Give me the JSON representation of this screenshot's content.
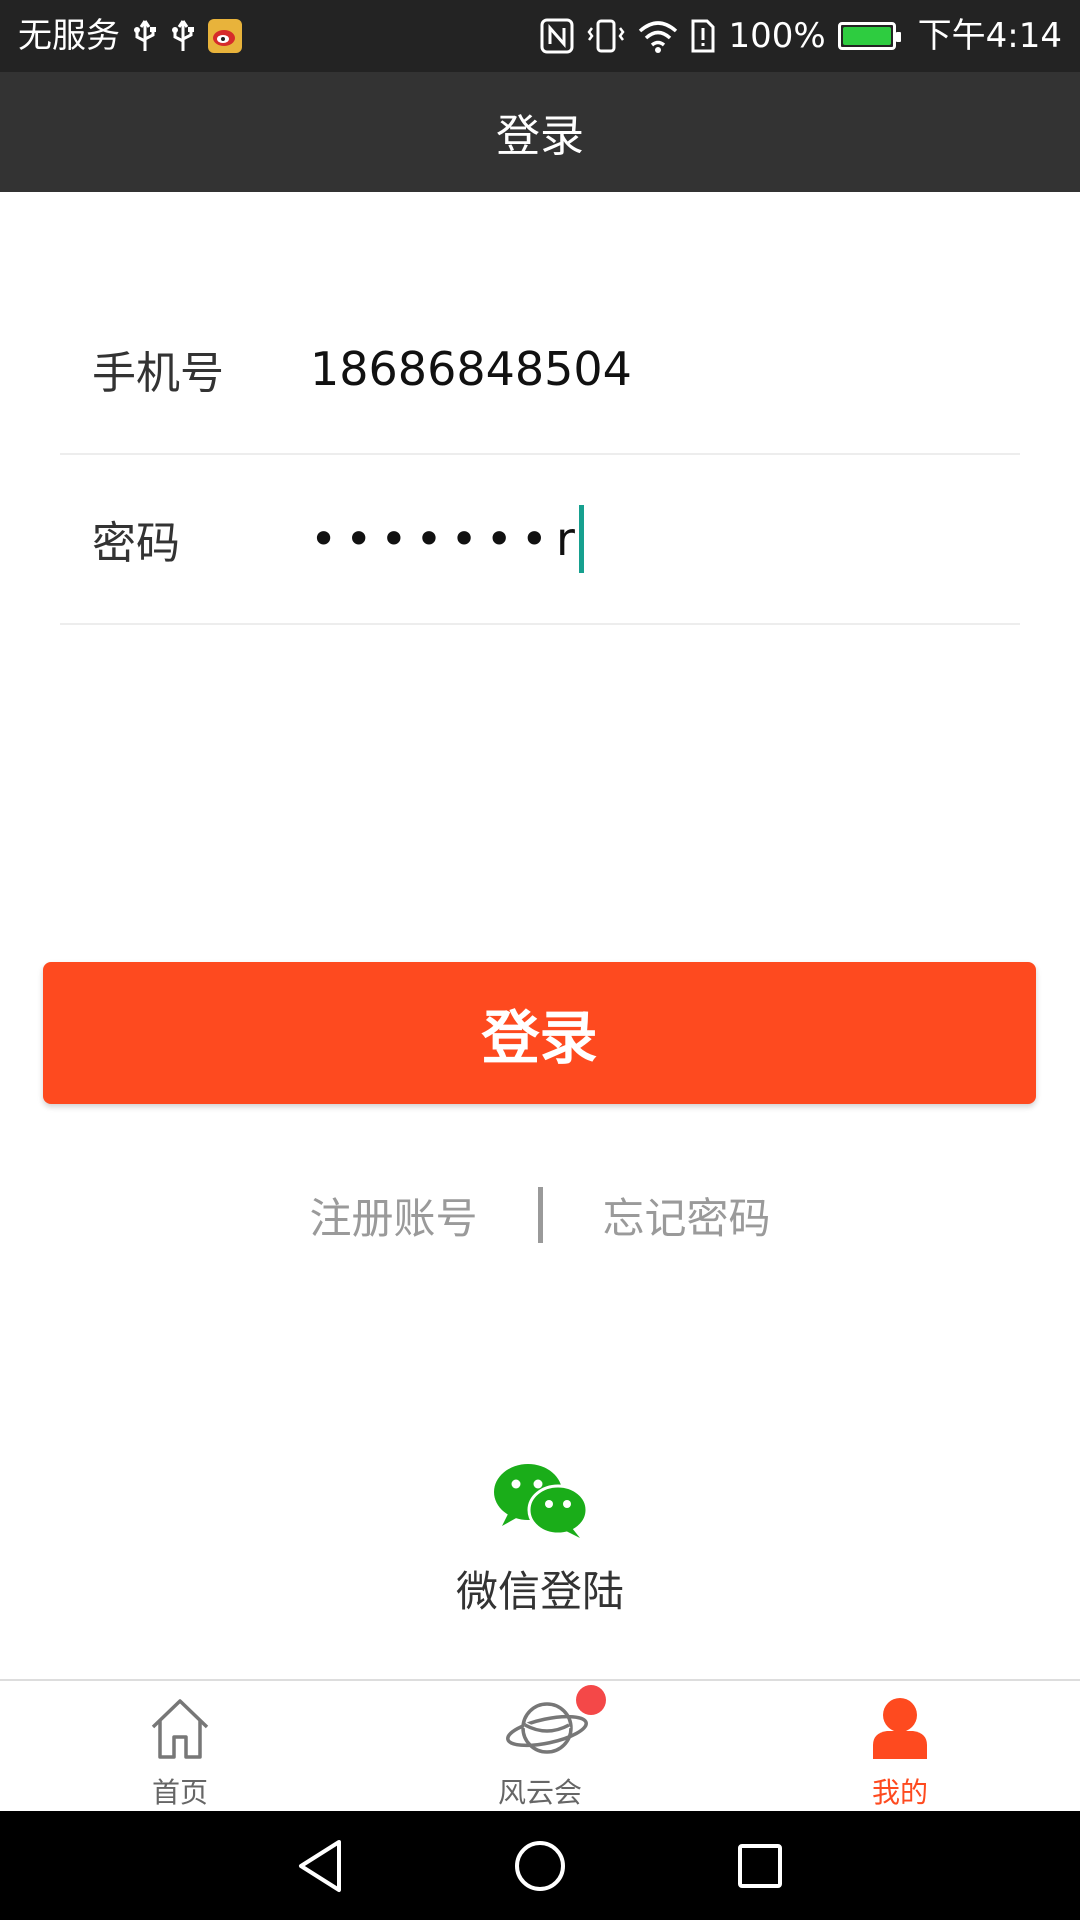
{
  "status_bar": {
    "carrier": "无服务",
    "battery_percent": "100%",
    "time": "下午4:14",
    "icons": [
      "usb-icon",
      "usb-icon",
      "weibo-icon",
      "nfc-icon",
      "vibrate-icon",
      "wifi-icon",
      "sim-alert-icon",
      "battery-charging-icon"
    ],
    "battery_color": "#2ecc40"
  },
  "header": {
    "title": "登录"
  },
  "form": {
    "phone_label": "手机号",
    "phone_value": "18686848504",
    "password_label": "密码",
    "password_masked": "•••••••",
    "password_last_char": "r"
  },
  "login_button": {
    "label": "登录",
    "color": "#fe4a1f"
  },
  "links": {
    "register": "注册账号",
    "forgot_password": "忘记密码"
  },
  "wechat": {
    "label": "微信登陆",
    "icon": "wechat-icon",
    "color": "#1aad19"
  },
  "tab_bar": {
    "tabs": [
      {
        "label": "首页",
        "icon": "home-icon",
        "active": false
      },
      {
        "label": "风云会",
        "icon": "planet-icon",
        "active": false,
        "badge": true
      },
      {
        "label": "我的",
        "icon": "user-icon",
        "active": true
      }
    ],
    "active_color": "#fe4a1f"
  },
  "nav_bar": {
    "buttons": [
      "back-icon",
      "home-circle-icon",
      "recents-icon"
    ]
  }
}
